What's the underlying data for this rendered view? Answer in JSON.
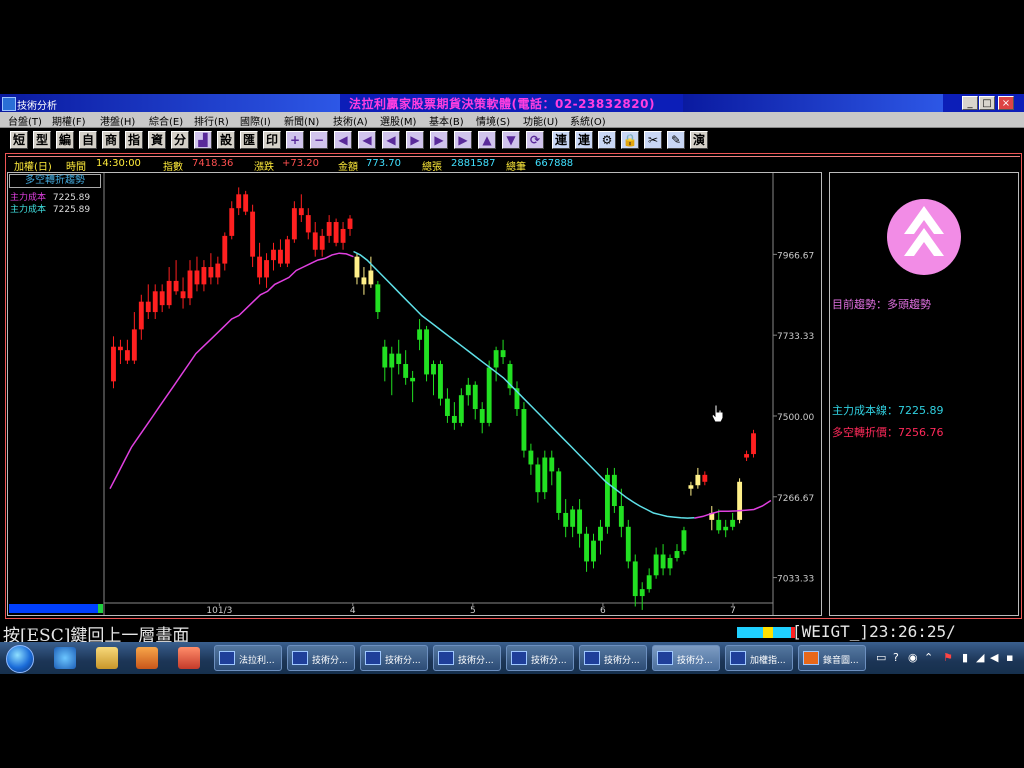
{
  "window": {
    "caption": "技術分析",
    "brand_title": "法拉利贏家股票期貨決策軟體(電話：02-23832820)",
    "controls": [
      "_",
      "□",
      "×"
    ]
  },
  "menu": [
    "台盤(T)",
    "期權(F)",
    "港盤(H)",
    "綜合(E)",
    "排行(R)",
    "國際(I)",
    "新聞(N)",
    "技術(A)",
    "選股(M)",
    "基本(B)",
    "情境(S)",
    "功能(U)",
    "系統(O)"
  ],
  "toolbar": {
    "text_buttons": [
      "短",
      "型",
      "編",
      "自",
      "商",
      "指",
      "資",
      "分"
    ],
    "text_buttons_2": [
      "設",
      "匯",
      "印"
    ],
    "arrow_buttons": [
      "+",
      "−",
      "◀",
      "◀",
      "◀",
      "▶",
      "▶",
      "▶",
      "▲",
      "▼"
    ],
    "text_buttons_3": [
      "連",
      "連"
    ],
    "last_button": "演"
  },
  "info_bar": {
    "instrument": "加權(日)",
    "time_label": "時間",
    "time": "14:30:00",
    "index_label": "指數",
    "index_value": "7418.36",
    "change_label": "漲跌",
    "change_value": "+73.20",
    "amount_label": "金額",
    "amount_value": "773.70",
    "sheets_label": "總張",
    "sheets_value": "2881587",
    "trades_label": "總筆",
    "trades_value": "667888"
  },
  "legend": {
    "title": "多空轉折趨勢",
    "rows": [
      {
        "label": "主力成本",
        "value": "7225.89",
        "color": "#e040e0"
      },
      {
        "label": "主力成本",
        "value": "7225.89",
        "color": "#40e0e0"
      }
    ]
  },
  "side_panel": {
    "trend_label": "目前趨勢：多頭趨勢",
    "cost_line": "主力成本線：7225.89",
    "turn_price": "多空轉折價：7256.76",
    "colors": {
      "trend": "#e070e0",
      "cost": "#30d0e0",
      "turn": "#ff2a5a"
    }
  },
  "chart_data": {
    "type": "candlestick",
    "y_ticks": [
      "7966.67",
      "7733.33",
      "7500.00",
      "7266.67",
      "7033.33"
    ],
    "x_ticks": [
      "101/3",
      "4",
      "5",
      "6",
      "7"
    ],
    "ylim": [
      6960,
      8190
    ],
    "candles": [
      [
        7600,
        7730,
        7580,
        7700,
        "red"
      ],
      [
        7700,
        7720,
        7650,
        7690,
        "red"
      ],
      [
        7690,
        7720,
        7650,
        7660,
        "red"
      ],
      [
        7660,
        7800,
        7650,
        7750,
        "red"
      ],
      [
        7750,
        7850,
        7720,
        7830,
        "red"
      ],
      [
        7830,
        7880,
        7780,
        7800,
        "red"
      ],
      [
        7800,
        7880,
        7780,
        7860,
        "red"
      ],
      [
        7860,
        7880,
        7800,
        7820,
        "red"
      ],
      [
        7820,
        7930,
        7810,
        7890,
        "red"
      ],
      [
        7890,
        7950,
        7850,
        7860,
        "red"
      ],
      [
        7860,
        7900,
        7810,
        7840,
        "red"
      ],
      [
        7840,
        7950,
        7820,
        7920,
        "red"
      ],
      [
        7920,
        7960,
        7860,
        7880,
        "red"
      ],
      [
        7880,
        7950,
        7860,
        7930,
        "red"
      ],
      [
        7930,
        7970,
        7880,
        7900,
        "red"
      ],
      [
        7900,
        7960,
        7880,
        7940,
        "red"
      ],
      [
        7940,
        8030,
        7920,
        8020,
        "red"
      ],
      [
        8020,
        8120,
        8010,
        8100,
        "red"
      ],
      [
        8100,
        8160,
        8080,
        8140,
        "red"
      ],
      [
        8140,
        8150,
        8080,
        8090,
        "red"
      ],
      [
        8090,
        8110,
        7930,
        7960,
        "red"
      ],
      [
        7960,
        8000,
        7880,
        7900,
        "red"
      ],
      [
        7900,
        7970,
        7870,
        7950,
        "red"
      ],
      [
        7950,
        8000,
        7920,
        7980,
        "red"
      ],
      [
        7980,
        8010,
        7930,
        7940,
        "red"
      ],
      [
        7940,
        8020,
        7930,
        8010,
        "red"
      ],
      [
        8010,
        8120,
        8000,
        8100,
        "red"
      ],
      [
        8100,
        8140,
        8060,
        8080,
        "red"
      ],
      [
        8080,
        8100,
        8010,
        8030,
        "red"
      ],
      [
        8030,
        8060,
        7960,
        7980,
        "red"
      ],
      [
        7980,
        8040,
        7960,
        8020,
        "red"
      ],
      [
        8020,
        8080,
        8000,
        8060,
        "red"
      ],
      [
        8060,
        8070,
        7990,
        8000,
        "red"
      ],
      [
        8000,
        8060,
        7980,
        8040,
        "red"
      ],
      [
        8040,
        8080,
        8020,
        8070,
        "red"
      ],
      [
        7960,
        7970,
        7880,
        7900,
        "yellow"
      ],
      [
        7900,
        7930,
        7850,
        7880,
        "yellow"
      ],
      [
        7880,
        7960,
        7870,
        7920,
        "yellow"
      ],
      [
        7880,
        7890,
        7780,
        7800,
        "green"
      ],
      [
        7700,
        7720,
        7600,
        7640,
        "green"
      ],
      [
        7640,
        7700,
        7560,
        7680,
        "green"
      ],
      [
        7680,
        7720,
        7620,
        7650,
        "green"
      ],
      [
        7650,
        7690,
        7590,
        7610,
        "green"
      ],
      [
        7610,
        7630,
        7540,
        7600,
        "green"
      ],
      [
        7720,
        7780,
        7690,
        7750,
        "green"
      ],
      [
        7750,
        7760,
        7600,
        7620,
        "green"
      ],
      [
        7620,
        7660,
        7560,
        7650,
        "green"
      ],
      [
        7650,
        7660,
        7530,
        7550,
        "green"
      ],
      [
        7550,
        7580,
        7480,
        7500,
        "green"
      ],
      [
        7500,
        7540,
        7460,
        7480,
        "green"
      ],
      [
        7480,
        7580,
        7470,
        7560,
        "green"
      ],
      [
        7560,
        7610,
        7530,
        7590,
        "green"
      ],
      [
        7590,
        7600,
        7490,
        7520,
        "green"
      ],
      [
        7520,
        7540,
        7450,
        7480,
        "green"
      ],
      [
        7480,
        7660,
        7470,
        7640,
        "green"
      ],
      [
        7640,
        7700,
        7600,
        7690,
        "green"
      ],
      [
        7690,
        7720,
        7650,
        7670,
        "green"
      ],
      [
        7650,
        7660,
        7560,
        7580,
        "green"
      ],
      [
        7580,
        7600,
        7500,
        7520,
        "green"
      ],
      [
        7520,
        7540,
        7380,
        7400,
        "green"
      ],
      [
        7400,
        7420,
        7330,
        7360,
        "green"
      ],
      [
        7360,
        7380,
        7250,
        7280,
        "green"
      ],
      [
        7280,
        7400,
        7260,
        7380,
        "green"
      ],
      [
        7380,
        7400,
        7300,
        7340,
        "green"
      ],
      [
        7340,
        7350,
        7200,
        7220,
        "green"
      ],
      [
        7220,
        7260,
        7150,
        7180,
        "green"
      ],
      [
        7180,
        7240,
        7150,
        7230,
        "green"
      ],
      [
        7230,
        7260,
        7120,
        7160,
        "green"
      ],
      [
        7160,
        7180,
        7050,
        7080,
        "green"
      ],
      [
        7080,
        7160,
        7060,
        7140,
        "green"
      ],
      [
        7140,
        7200,
        7100,
        7180,
        "green"
      ],
      [
        7180,
        7350,
        7160,
        7330,
        "green"
      ],
      [
        7330,
        7350,
        7220,
        7240,
        "green"
      ],
      [
        7240,
        7290,
        7150,
        7180,
        "green"
      ],
      [
        7180,
        7200,
        7060,
        7080,
        "green"
      ],
      [
        7080,
        7100,
        6950,
        6980,
        "green"
      ],
      [
        6980,
        7020,
        6940,
        7000,
        "green"
      ],
      [
        7000,
        7060,
        6990,
        7040,
        "green"
      ],
      [
        7040,
        7120,
        7030,
        7100,
        "green"
      ],
      [
        7100,
        7130,
        7040,
        7060,
        "green"
      ],
      [
        7060,
        7100,
        7040,
        7090,
        "green"
      ],
      [
        7090,
        7130,
        7080,
        7110,
        "green"
      ],
      [
        7110,
        7180,
        7100,
        7170,
        "green"
      ],
      [
        7290,
        7310,
        7270,
        7300,
        "yellow"
      ],
      [
        7300,
        7350,
        7290,
        7330,
        "yellow"
      ],
      [
        7330,
        7340,
        7300,
        7310,
        "red"
      ],
      [
        7220,
        7240,
        7170,
        7200,
        "yellow"
      ],
      [
        7200,
        7230,
        7160,
        7170,
        "green"
      ],
      [
        7170,
        7200,
        7150,
        7180,
        "green"
      ],
      [
        7180,
        7220,
        7170,
        7200,
        "green"
      ],
      [
        7200,
        7320,
        7190,
        7310,
        "yellow"
      ],
      [
        7380,
        7400,
        7370,
        7390,
        "red"
      ],
      [
        7390,
        7460,
        7380,
        7450,
        "red"
      ]
    ],
    "cost_line": [
      7290,
      7330,
      7370,
      7410,
      7440,
      7470,
      7500,
      7530,
      7560,
      7590,
      7620,
      7650,
      7680,
      7700,
      7720,
      7740,
      7760,
      7780,
      7790,
      7810,
      7830,
      7850,
      7860,
      7880,
      7890,
      7900,
      7920,
      7930,
      7940,
      7950,
      7955,
      7965,
      7970,
      7968,
      7960
    ],
    "turn_line": [
      7975,
      7965,
      7950,
      7930,
      7910,
      7890,
      7870,
      7850,
      7830,
      7810,
      7790,
      7775,
      7760,
      7745,
      7730,
      7715,
      7700,
      7685,
      7670,
      7655,
      7640,
      7625,
      7610,
      7590,
      7570,
      7550,
      7530,
      7510,
      7490,
      7470,
      7450,
      7430,
      7410,
      7390,
      7370,
      7350,
      7330,
      7310,
      7295,
      7280,
      7265,
      7252,
      7240,
      7230,
      7220,
      7215,
      7210,
      7208,
      7206,
      7205,
      7206
    ],
    "ma_tail": [
      7205,
      7210,
      7218,
      7225,
      7225,
      7226,
      7228,
      7230,
      7240,
      7256
    ]
  },
  "status_bar": {
    "esc_hint": "按[ESC]鍵回上一層畫面",
    "weigt": "[WEIGT_]23:26:25/"
  },
  "taskbar": {
    "tasks": [
      "法拉利...",
      "技術分...",
      "技術分...",
      "技術分...",
      "技術分...",
      "技術分...",
      "技術分...",
      "加權指...",
      "錄音圖..."
    ],
    "active_index": 6
  }
}
